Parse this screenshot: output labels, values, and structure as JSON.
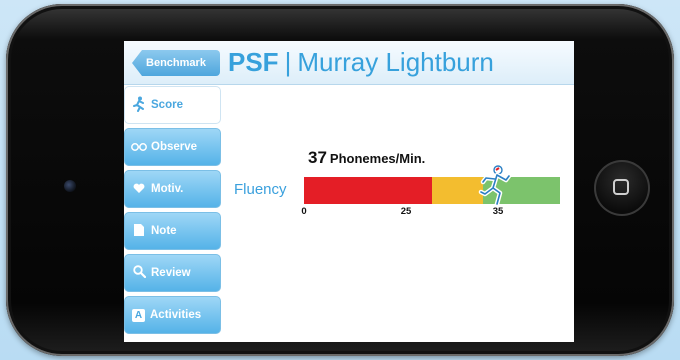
{
  "header": {
    "back_label": "Benchmark",
    "title_abbr": "PSF",
    "title_sep": "|",
    "student_name": "Murray Lightburn"
  },
  "sidebar": {
    "items": [
      {
        "label": "Score",
        "icon": "runner-icon",
        "active": true
      },
      {
        "label": "Observe",
        "icon": "glasses-icon",
        "active": false
      },
      {
        "label": "Motiv.",
        "icon": "heart-icon",
        "active": false
      },
      {
        "label": "Note",
        "icon": "note-icon",
        "active": false
      },
      {
        "label": "Review",
        "icon": "magnifier-icon",
        "active": false
      },
      {
        "label": "Activities",
        "icon": "activities-icon",
        "active": false
      }
    ]
  },
  "score": {
    "value": "37",
    "unit": "Phonemes/Min."
  },
  "fluency": {
    "label": "Fluency",
    "ticks": [
      "0",
      "25",
      "35"
    ],
    "bands": [
      {
        "name": "red",
        "from": 0,
        "to": 25,
        "color": "#e41e26"
      },
      {
        "name": "yellow",
        "from": 25,
        "to": 35,
        "color": "#f3bd2f"
      },
      {
        "name": "green",
        "from": 35,
        "to": 50,
        "color": "#7cc36c"
      }
    ],
    "scale_max": 50,
    "marker_value": 37
  },
  "colors": {
    "accent": "#37a1dc",
    "device": "#050505",
    "background": "#cde6f7"
  }
}
